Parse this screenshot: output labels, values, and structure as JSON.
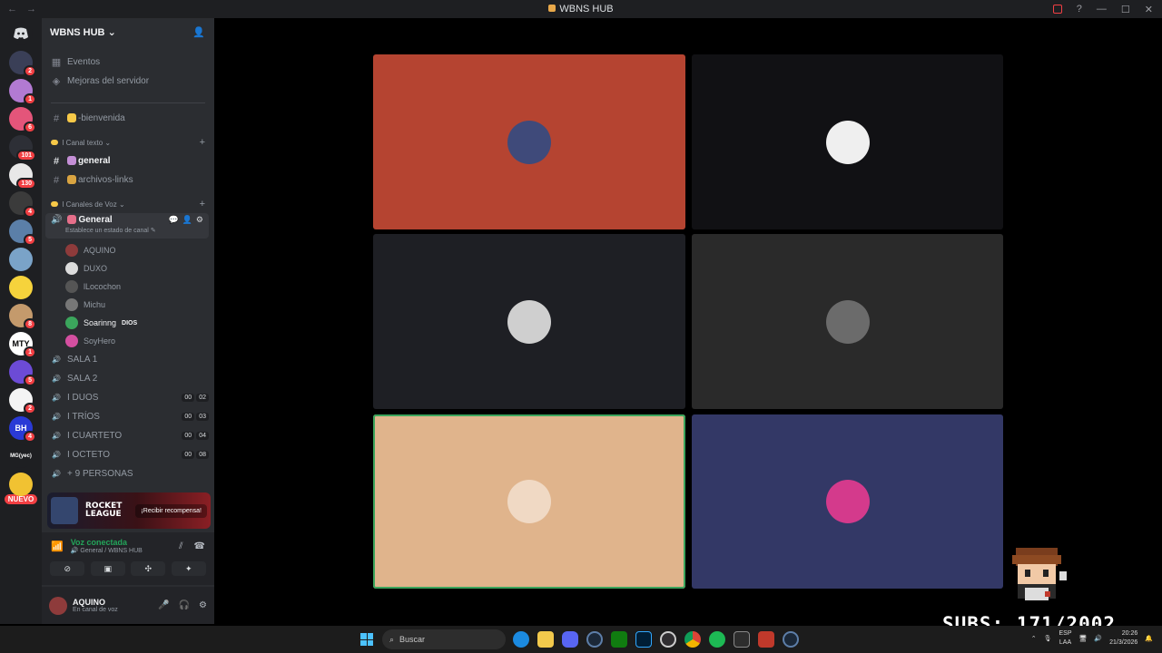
{
  "window": {
    "title": "WBNS HUB",
    "back": "←",
    "forward": "→"
  },
  "rail": {
    "servers": [
      {
        "badge": "2",
        "color": "#3a3f57"
      },
      {
        "badge": "1",
        "color": "#b27ad2"
      },
      {
        "badge": "6",
        "color": "#e4557a"
      },
      {
        "badge": "101",
        "color": "#2d2f36"
      },
      {
        "badge": "130",
        "color": "#e8e8e8"
      },
      {
        "badge": "4",
        "color": "#3b3b3b"
      },
      {
        "badge": "5",
        "color": "#5b7fa8"
      },
      {
        "badge": "",
        "color": "#7aa3c8"
      },
      {
        "badge": "",
        "color": "#f6d33c"
      },
      {
        "badge": "8",
        "color": "#c49a6c"
      },
      {
        "badge": "1",
        "color": "#ffffff",
        "text": "MTY"
      },
      {
        "badge": "5",
        "color": "#6c4bd6"
      },
      {
        "badge": "2",
        "color": "#f4f4f4"
      },
      {
        "badge": "4",
        "color": "#2a3ad6",
        "text": "BH"
      },
      {
        "badge": "",
        "color": "#1e1f22",
        "text": "MG(yec)"
      },
      {
        "badge": "",
        "color": "#f1c232"
      }
    ],
    "new_label": "NUEVO"
  },
  "sidebar": {
    "server_name": "WBNS HUB",
    "top_items": [
      {
        "label": "Eventos",
        "icon": "calendar-icon"
      },
      {
        "label": "Mejoras del servidor",
        "icon": "boost-icon"
      }
    ],
    "welcome": "-bienvenida",
    "cat_text": "I Canal texto",
    "text_channels": [
      "general",
      "archivos-links"
    ],
    "cat_voice": "I Canales de Voz",
    "voice_active": {
      "name": "General",
      "status": "Establece un estado de canal"
    },
    "voice_users": [
      {
        "name": "AQUINO",
        "color": "#8e3b3b"
      },
      {
        "name": "DUXO",
        "color": "#dcdcdc"
      },
      {
        "name": "lLocochon",
        "color": "#555"
      },
      {
        "name": "Michu",
        "color": "#777"
      },
      {
        "name": "Soarinng",
        "tag": "DIOS",
        "color": "#3ba55c"
      },
      {
        "name": "SoyHero",
        "color": "#d44fa0"
      }
    ],
    "voice_channels": [
      {
        "name": "SALA 1",
        "counts": []
      },
      {
        "name": "SALA 2",
        "counts": []
      },
      {
        "name": "I  DUOS",
        "counts": [
          "00",
          "02"
        ]
      },
      {
        "name": "I  TRÍOS",
        "counts": [
          "00",
          "03"
        ]
      },
      {
        "name": "I  CUARTETO",
        "counts": [
          "00",
          "04"
        ]
      },
      {
        "name": "I  OCTETO",
        "counts": [
          "00",
          "08"
        ]
      },
      {
        "name": "+ 9 PERSONAS",
        "counts": []
      }
    ]
  },
  "promo": {
    "logo_line1": "ROCKET",
    "logo_line2": "LEAGUE",
    "button": "¡Recibir recompensa!"
  },
  "voice_panel": {
    "status": "Voz conectada",
    "location": "General / WBNS HUB"
  },
  "user_panel": {
    "name": "AQUINO",
    "status": "En canal de voz"
  },
  "tiles": [
    {
      "bg": "#b54431",
      "avatar": "#3f4a7a"
    },
    {
      "bg": "#111114",
      "avatar": "#efefef"
    },
    {
      "bg": "#1e1f24",
      "avatar": "#cfcfcf"
    },
    {
      "bg": "#2a2a2a",
      "avatar": "#6b6b6b"
    },
    {
      "bg": "#e0b48c",
      "avatar": "#f0d9c4"
    },
    {
      "bg": "#333866",
      "avatar": "#d43a8c"
    }
  ],
  "overlay": {
    "subs": "SUBS: 171/2002"
  },
  "taskbar": {
    "search": "Buscar",
    "lang1": "ESP",
    "lang2": "LAA",
    "time": "20:26",
    "date": "21/3/2026"
  }
}
